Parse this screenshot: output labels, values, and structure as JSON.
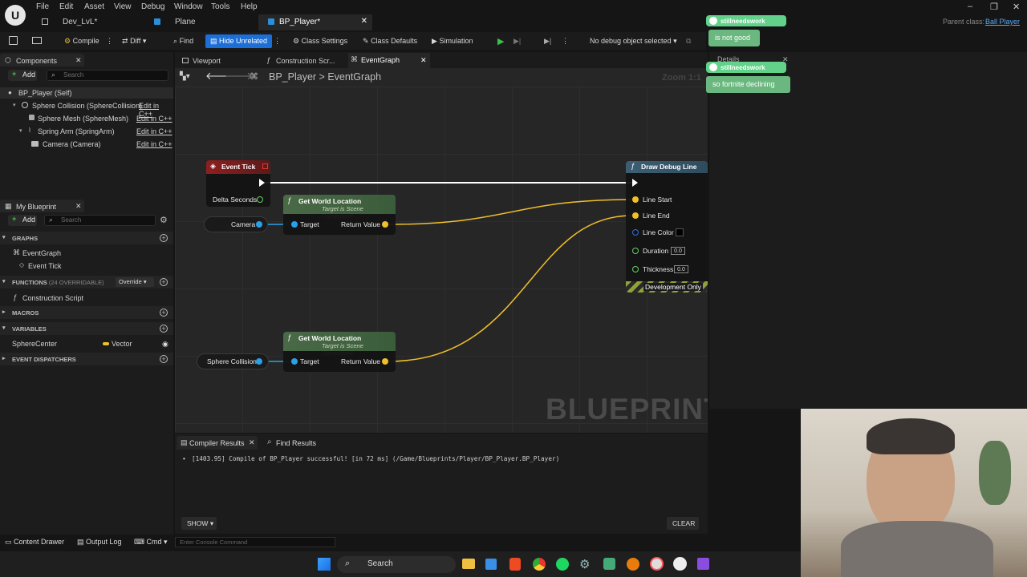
{
  "menu": [
    "File",
    "Edit",
    "Asset",
    "View",
    "Debug",
    "Window",
    "Tools",
    "Help"
  ],
  "doc_tabs": [
    {
      "label": "Dev_LvL*",
      "active": false
    },
    {
      "label": "Plane",
      "active": false
    },
    {
      "label": "BP_Player*",
      "active": true
    }
  ],
  "parent_class": {
    "label": "Parent class:",
    "value": "Ball Player"
  },
  "toolbar": {
    "compile": "Compile",
    "diff": "Diff",
    "find": "Find",
    "hide_unrelated": "Hide Unrelated",
    "class_settings": "Class Settings",
    "class_defaults": "Class Defaults",
    "simulation": "Simulation",
    "debug_object": "No debug object selected"
  },
  "components": {
    "title": "Components",
    "add": "Add",
    "search_placeholder": "Search",
    "items": [
      {
        "label": "BP_Player (Self)",
        "edit": ""
      },
      {
        "label": "Sphere Collision (SphereCollision)",
        "edit": "Edit in C++"
      },
      {
        "label": "Sphere Mesh (SphereMesh)",
        "edit": "Edit in C++"
      },
      {
        "label": "Spring Arm (SpringArm)",
        "edit": "Edit in C++"
      },
      {
        "label": "Camera (Camera)",
        "edit": "Edit in C++"
      }
    ]
  },
  "my_blueprint": {
    "title": "My Blueprint",
    "add": "Add",
    "search_placeholder": "Search",
    "graphs_header": "GRAPHS",
    "event_graph": "EventGraph",
    "event_tick": "Event Tick",
    "functions_header": "FUNCTIONS",
    "functions_count": "(24 OVERRIDABLE)",
    "override": "Override",
    "construction_script": "Construction Script",
    "macros_header": "MACROS",
    "variables_header": "VARIABLES",
    "variable_name": "SphereCenter",
    "variable_type": "Vector",
    "dispatchers_header": "EVENT DISPATCHERS"
  },
  "editor_tabs": [
    "Viewport",
    "Construction Scr...",
    "EventGraph"
  ],
  "breadcrumb": {
    "root": "BP_Player",
    "sep": ">",
    "graph": "EventGraph"
  },
  "zoom": "Zoom 1:1",
  "watermark": "BLUEPRINT",
  "nodes": {
    "event_tick": {
      "title": "Event Tick",
      "pin": "Delta Seconds"
    },
    "camera": "Camera",
    "sphere_collision": "Sphere Collision",
    "gwl1": {
      "title": "Get World Location",
      "subtitle": "Target is Scene Component",
      "in": "Target",
      "out": "Return Value"
    },
    "gwl2": {
      "title": "Get World Location",
      "subtitle": "Target is Scene Component",
      "in": "Target",
      "out": "Return Value"
    },
    "draw_debug": {
      "title": "Draw Debug Line",
      "line_start": "Line Start",
      "line_end": "Line End",
      "line_color": "Line Color",
      "duration": "Duration",
      "duration_val": "0.0",
      "thickness": "Thickness",
      "thickness_val": "0.0",
      "footer": "Development Only"
    }
  },
  "bottom_tabs": [
    "Compiler Results",
    "Find Results"
  ],
  "compiler_message": "[1403.95] Compile of BP_Player successful! [in 72 ms] (/Game/Blueprints/Player/BP_Player.BP_Player)",
  "show_btn": "SHOW",
  "clear_btn": "CLEAR",
  "status_bar": {
    "content_drawer": "Content Drawer",
    "output_log": "Output Log",
    "cmd": "Cmd",
    "console_placeholder": "Enter Console Command"
  },
  "taskbar": {
    "search": "Search"
  },
  "chat": [
    {
      "user": "stillneedswork",
      "message": "is not good"
    },
    {
      "user": "stillneedswork",
      "message": "so fortnite declining"
    }
  ],
  "details_tab": "Details",
  "colors": {
    "accent": "#1d6fd8",
    "event_node": "#8e1f1f",
    "pure_node": "#3a6a3a",
    "vector_wire": "#f0c02a",
    "chat": "#62d28a"
  }
}
